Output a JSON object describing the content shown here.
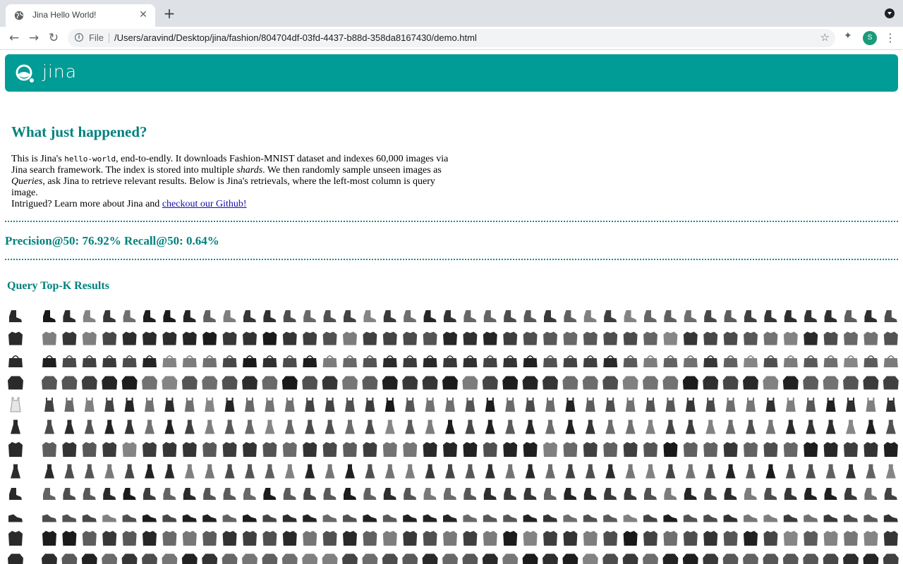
{
  "browser": {
    "tab_title": "Jina Hello World!",
    "tab_close_icon": "close-icon",
    "new_tab_icon": "plus-icon",
    "back_icon": "arrow-left-icon",
    "forward_icon": "arrow-right-icon",
    "reload_icon": "reload-icon",
    "url_scheme": "File",
    "url": "/Users/aravind/Desktop/jina/fashion/804704df-03fd-4437-b88d-358da8167430/demo.html",
    "avatar_letter": "S"
  },
  "page": {
    "brand": "jina",
    "brand_color": "#009c95",
    "heading": "What just happened?",
    "intro": {
      "t1": "This is Jina's ",
      "code": "hello-world",
      "t2": ", end-to-endly. It downloads Fashion-MNIST dataset and indexes 60,000 images via Jina search framework. The index is stored into multiple ",
      "shards": "shards",
      "t3": ". We then randomly sample unseen images as ",
      "queries": "Queries",
      "t4": ", ask Jina to retrieve relevant results. Below is Jina's retrievals, where the left-most column is query image.",
      "t5": "Intrigued? Learn more about Jina and ",
      "link": "checkout our Github!"
    },
    "metrics": "Precision@50: 76.92% Recall@50: 0.64%",
    "results_heading": "Query Top-K Results"
  },
  "results": {
    "row_categories": [
      "ankle-boot",
      "jacket",
      "bag",
      "pullover",
      "top",
      "dress",
      "coat",
      "dress",
      "ankle-boot",
      "sneaker",
      "coat",
      "pullover"
    ],
    "results_per_row": 43
  }
}
